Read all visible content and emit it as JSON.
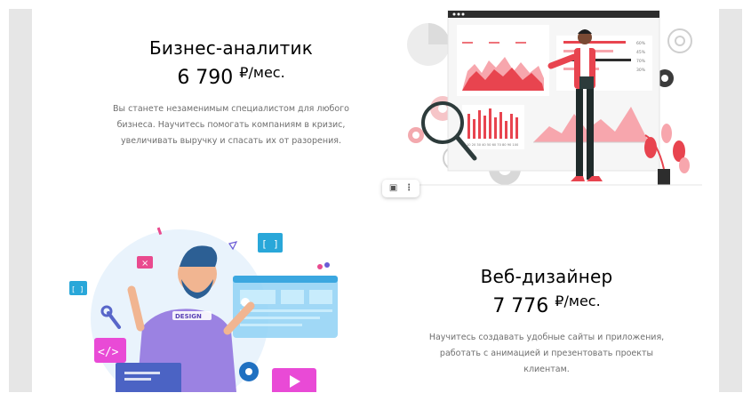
{
  "courses": [
    {
      "title": "Бизнес-аналитик",
      "price": "6 790",
      "unit": "₽/мес.",
      "description_lines": [
        "Вы станете незаменимым специалистом для любого",
        "бизнеса. Научитесь помогать компаниям в кризис,",
        "увеличивать выручку и спасать их от разорения."
      ],
      "chart_ticks": "10 20 30 40 50 60 70 80 90 100",
      "legend_values": [
        "60%",
        "45%",
        "70%",
        "30%"
      ]
    },
    {
      "title": "Веб-дизайнер",
      "price": "7 776",
      "unit": "₽/мес.",
      "description_lines": [
        "Научитесь создавать удобные сайты и приложения,",
        "работать с анимацией и презентовать проекты",
        "клиентам."
      ],
      "shirt_text": "DESIGN",
      "bracket_label": "[ ]",
      "code_label": "</>"
    }
  ],
  "image_tools": {
    "camera_icon": "camera-icon",
    "more_icon": "more-vertical-icon"
  },
  "colors": {
    "accent_red": "#e8444f",
    "accent_pink": "#f7a6ad",
    "purple": "#8b6fd6",
    "light_blue": "#cfe8f9",
    "side_gray": "#e6e6e6"
  }
}
